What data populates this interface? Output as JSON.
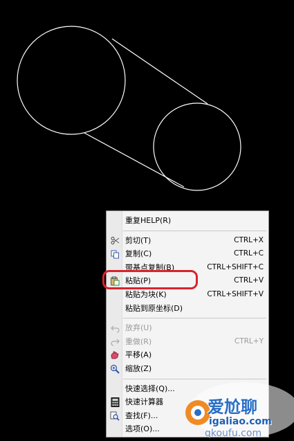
{
  "menu": {
    "items": [
      {
        "label": "重复HELP(R)",
        "shortcut": "",
        "icon": "none",
        "disabled": false
      },
      {
        "sep": true
      },
      {
        "label": "剪切(T)",
        "shortcut": "CTRL+X",
        "icon": "scissors-icon",
        "disabled": false
      },
      {
        "label": "复制(C)",
        "shortcut": "CTRL+C",
        "icon": "copy-icon",
        "disabled": false
      },
      {
        "label": "带基点复制(B)",
        "shortcut": "CTRL+SHIFT+C",
        "icon": "none",
        "disabled": false
      },
      {
        "label": "粘贴(P)",
        "shortcut": "CTRL+V",
        "icon": "clipboard-icon",
        "disabled": false
      },
      {
        "label": "粘贴为块(K)",
        "shortcut": "CTRL+SHIFT+V",
        "icon": "none",
        "disabled": false
      },
      {
        "label": "粘贴到原坐标(D)",
        "shortcut": "",
        "icon": "none",
        "disabled": false
      },
      {
        "sep": true
      },
      {
        "label": "放弃(U)",
        "shortcut": "",
        "icon": "undo-icon",
        "disabled": true
      },
      {
        "label": "重做(R)",
        "shortcut": "CTRL+Y",
        "icon": "redo-icon",
        "disabled": true
      },
      {
        "label": "平移(A)",
        "shortcut": "",
        "icon": "pan-icon",
        "disabled": false
      },
      {
        "label": "缩放(Z)",
        "shortcut": "",
        "icon": "zoom-icon",
        "disabled": false
      },
      {
        "sep": true
      },
      {
        "label": "快速选择(Q)...",
        "shortcut": "",
        "icon": "none",
        "disabled": false
      },
      {
        "label": "快速计算器",
        "shortcut": "",
        "icon": "calculator-icon",
        "disabled": false
      },
      {
        "label": "查找(F)...",
        "shortcut": "",
        "icon": "find-icon",
        "disabled": false
      },
      {
        "label": "选项(O)...",
        "shortcut": "",
        "icon": "none",
        "disabled": false
      }
    ]
  },
  "colors": {
    "highlight": "#d9232d",
    "canvas_bg": "#000000",
    "drawing_line": "#ffffff"
  },
  "watermark": {
    "text": "爱尬聊",
    "url": "igaliao.com",
    "sub": "qkoufu.com"
  }
}
